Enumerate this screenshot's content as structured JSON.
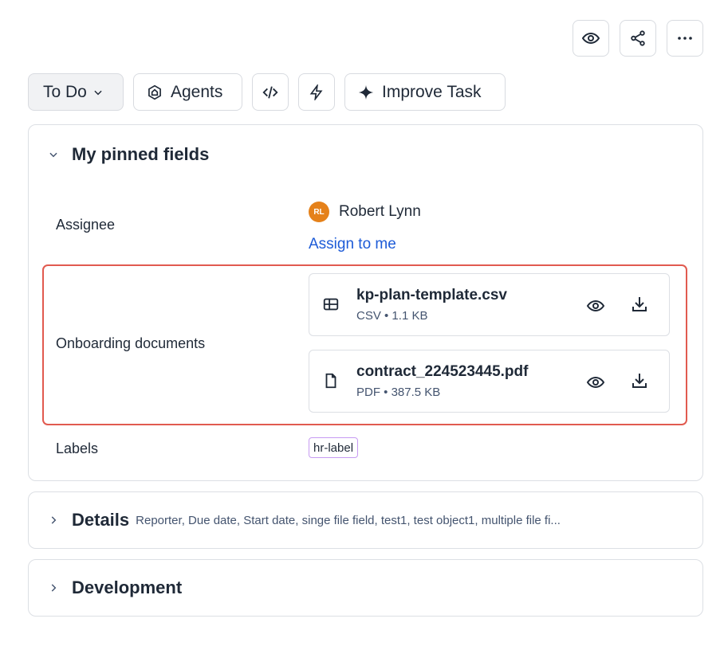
{
  "header_actions": {
    "watch_icon": "eye-icon",
    "share_icon": "share-icon",
    "more_icon": "more-icon"
  },
  "toolbar": {
    "status_label": "To Do",
    "agents_label": "Agents",
    "improve_label": "Improve Task"
  },
  "pinned": {
    "title": "My pinned fields",
    "assignee": {
      "label": "Assignee",
      "initials": "RL",
      "name": "Robert Lynn",
      "assign_to_me": "Assign to me"
    },
    "onboarding": {
      "label": "Onboarding documents",
      "files": [
        {
          "name": "kp-plan-template.csv",
          "meta": "CSV • 1.1 KB",
          "icon": "table-icon"
        },
        {
          "name": "contract_224523445.pdf",
          "meta": "PDF • 387.5 KB",
          "icon": "file-icon"
        }
      ]
    },
    "labels": {
      "label": "Labels",
      "tag": "hr-label"
    }
  },
  "details": {
    "title": "Details",
    "summary": "Reporter, Due date, Start date, singe file field, test1, test object1, multiple file fi..."
  },
  "development": {
    "title": "Development"
  },
  "colors": {
    "accent_link": "#1d5bd7",
    "highlight_border": "#e15a4f",
    "avatar": "#e5811a",
    "tag_border": "#c79bf2"
  }
}
